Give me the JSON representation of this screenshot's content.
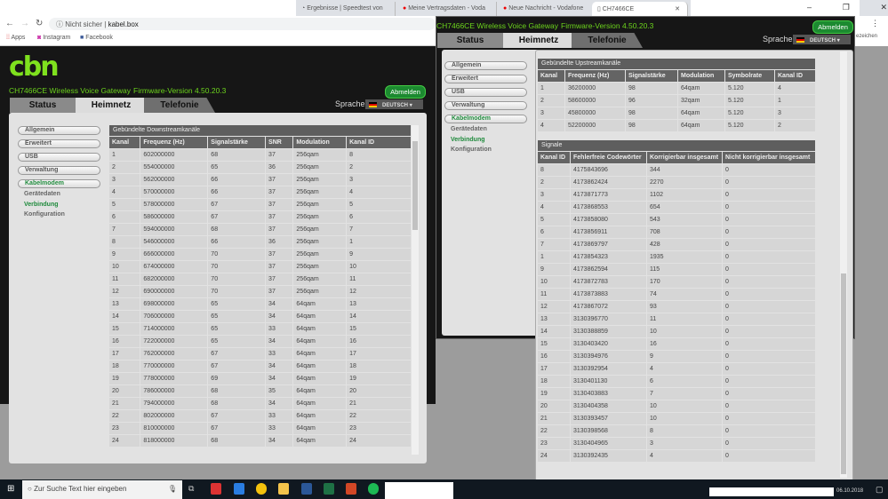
{
  "browser": {
    "tabs": [
      {
        "label": "Ergebnisse | Speedtest von",
        "icon": "speedometer-icon"
      },
      {
        "label": "Meine Vertragsdaten - Voda",
        "icon": "vodafone-icon"
      },
      {
        "label": "Neue Nachricht - Vodafone",
        "icon": "vodafone-icon"
      },
      {
        "label": "CH7466CE",
        "icon": "page-icon"
      }
    ],
    "security": "Nicht sicher",
    "url": "kabel.box",
    "bookmarks": [
      "Apps",
      "Instagram",
      "Facebook"
    ],
    "bookmarks_overflow": "ezeichen"
  },
  "router": {
    "model": "CH7466CE  Wireless Voice Gateway",
    "firmware": "Firmware-Version  4.50.20.3",
    "logo": "cbn",
    "logout": "Abmelden",
    "tabs": [
      "Status",
      "Heimnetz",
      "Telefonie"
    ],
    "lang_label": "Sprache",
    "lang": "DEUTSCH",
    "sidebar": [
      "Allgemein",
      "Erweitert",
      "USB",
      "Verwaltung",
      "Kabelmodem"
    ],
    "subnav": [
      "Gerätedaten",
      "Verbindung",
      "Konfiguration"
    ]
  },
  "downstream": {
    "title": "Gebündelte Downstreamkanäle",
    "headers": [
      "Kanal",
      "Frequenz (Hz)",
      "Signalstärke",
      "SNR",
      "Modulation",
      "Kanal ID"
    ],
    "rows": [
      [
        "1",
        "602000000",
        "68",
        "37",
        "256qam",
        "8"
      ],
      [
        "2",
        "554000000",
        "65",
        "36",
        "256qam",
        "2"
      ],
      [
        "3",
        "562000000",
        "66",
        "37",
        "256qam",
        "3"
      ],
      [
        "4",
        "570000000",
        "66",
        "37",
        "256qam",
        "4"
      ],
      [
        "5",
        "578000000",
        "67",
        "37",
        "256qam",
        "5"
      ],
      [
        "6",
        "586000000",
        "67",
        "37",
        "256qam",
        "6"
      ],
      [
        "7",
        "594000000",
        "68",
        "37",
        "256qam",
        "7"
      ],
      [
        "8",
        "546000000",
        "66",
        "36",
        "256qam",
        "1"
      ],
      [
        "9",
        "666000000",
        "70",
        "37",
        "256qam",
        "9"
      ],
      [
        "10",
        "674000000",
        "70",
        "37",
        "256qam",
        "10"
      ],
      [
        "11",
        "682000000",
        "70",
        "37",
        "256qam",
        "11"
      ],
      [
        "12",
        "690000000",
        "70",
        "37",
        "256qam",
        "12"
      ],
      [
        "13",
        "698000000",
        "65",
        "34",
        "64qam",
        "13"
      ],
      [
        "14",
        "706000000",
        "65",
        "34",
        "64qam",
        "14"
      ],
      [
        "15",
        "714000000",
        "65",
        "33",
        "64qam",
        "15"
      ],
      [
        "16",
        "722000000",
        "65",
        "34",
        "64qam",
        "16"
      ],
      [
        "17",
        "762000000",
        "67",
        "33",
        "64qam",
        "17"
      ],
      [
        "18",
        "770000000",
        "67",
        "34",
        "64qam",
        "18"
      ],
      [
        "19",
        "778000000",
        "69",
        "34",
        "64qam",
        "19"
      ],
      [
        "20",
        "786000000",
        "68",
        "35",
        "64qam",
        "20"
      ],
      [
        "21",
        "794000000",
        "68",
        "34",
        "64qam",
        "21"
      ],
      [
        "22",
        "802000000",
        "67",
        "33",
        "64qam",
        "22"
      ],
      [
        "23",
        "810000000",
        "67",
        "33",
        "64qam",
        "23"
      ],
      [
        "24",
        "818000000",
        "68",
        "34",
        "64qam",
        "24"
      ]
    ]
  },
  "upstream": {
    "title": "Gebündelte Upstreamkanäle",
    "headers": [
      "Kanal",
      "Frequenz (Hz)",
      "Signalstärke",
      "Modulation",
      "Symbolrate",
      "Kanal ID"
    ],
    "rows": [
      [
        "1",
        "36200000",
        "98",
        "64qam",
        "5.120",
        "4"
      ],
      [
        "2",
        "58600000",
        "96",
        "32qam",
        "5.120",
        "1"
      ],
      [
        "3",
        "45800000",
        "98",
        "64qam",
        "5.120",
        "3"
      ],
      [
        "4",
        "52200000",
        "98",
        "64qam",
        "5.120",
        "2"
      ]
    ]
  },
  "signals": {
    "title": "Signale",
    "headers": [
      "Kanal ID",
      "Fehlerfreie Codewörter",
      "Korrigierbar insgesamt",
      "Nicht korrigierbar insgesamt"
    ],
    "rows": [
      [
        "8",
        "4175843696",
        "344",
        "0"
      ],
      [
        "2",
        "4173862424",
        "2270",
        "0"
      ],
      [
        "3",
        "4173871773",
        "1102",
        "0"
      ],
      [
        "4",
        "4173868553",
        "654",
        "0"
      ],
      [
        "5",
        "4173858080",
        "543",
        "0"
      ],
      [
        "6",
        "4173856911",
        "708",
        "0"
      ],
      [
        "7",
        "4173869797",
        "428",
        "0"
      ],
      [
        "1",
        "4173854323",
        "1935",
        "0"
      ],
      [
        "9",
        "4173862594",
        "115",
        "0"
      ],
      [
        "10",
        "4173872783",
        "170",
        "0"
      ],
      [
        "11",
        "4173873883",
        "74",
        "0"
      ],
      [
        "12",
        "4173867072",
        "93",
        "0"
      ],
      [
        "13",
        "3130396770",
        "11",
        "0"
      ],
      [
        "14",
        "3130388859",
        "10",
        "0"
      ],
      [
        "15",
        "3130403420",
        "16",
        "0"
      ],
      [
        "16",
        "3130394976",
        "9",
        "0"
      ],
      [
        "17",
        "3130392954",
        "4",
        "0"
      ],
      [
        "18",
        "3130401130",
        "6",
        "0"
      ],
      [
        "19",
        "3130403883",
        "7",
        "0"
      ],
      [
        "20",
        "3130404358",
        "10",
        "0"
      ],
      [
        "21",
        "3130393457",
        "10",
        "0"
      ],
      [
        "22",
        "3130398568",
        "8",
        "0"
      ],
      [
        "23",
        "3130404965",
        "3",
        "0"
      ],
      [
        "24",
        "3130392435",
        "4",
        "0"
      ]
    ]
  },
  "taskbar": {
    "search_placeholder": "Zur Suche Text hier eingeben",
    "date": "06.10.2018"
  },
  "colors": {
    "accent_green": "#6cd41c",
    "active_nav": "#1f8a3c",
    "logout": "#1c8a30"
  }
}
